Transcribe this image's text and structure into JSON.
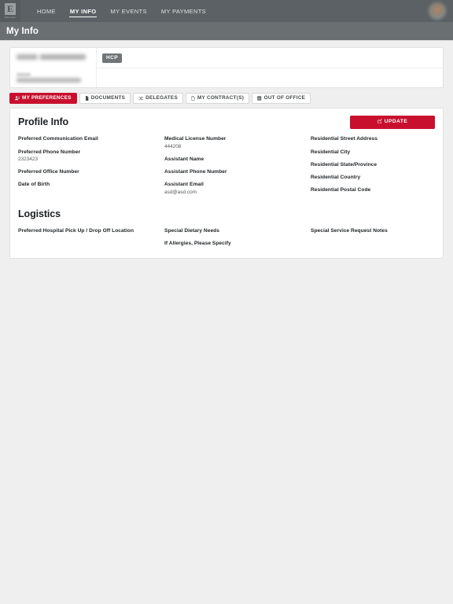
{
  "brand": {
    "logo_letter": "E",
    "logo_word": "Edwards",
    "accent_color": "#c8102e",
    "nav_color": "#5b6164",
    "titlebar_color": "#6a6f72"
  },
  "nav": {
    "items": [
      {
        "label": "HOME",
        "active": false
      },
      {
        "label": "MY INFO",
        "active": true
      },
      {
        "label": "MY EVENTS",
        "active": false
      },
      {
        "label": "MY PAYMENTS",
        "active": false
      }
    ],
    "avatar_icon": "user-avatar"
  },
  "page": {
    "title": "My Info"
  },
  "identity_card": {
    "name_redacted": true,
    "email_redacted": true,
    "badge": "HCP"
  },
  "tabs": [
    {
      "label": "MY PREFERENCES",
      "icon": "preferences-icon",
      "active": true
    },
    {
      "label": "DOCUMENTS",
      "icon": "document-icon",
      "active": false
    },
    {
      "label": "DELEGATES",
      "icon": "delegates-icon",
      "active": false
    },
    {
      "label": "MY CONTRACT(S)",
      "icon": "contract-icon",
      "active": false
    },
    {
      "label": "OUT OF OFFICE",
      "icon": "calendar-icon",
      "active": false
    }
  ],
  "profile_info": {
    "heading": "Profile Info",
    "update_label": "UPDATE",
    "update_icon": "edit-icon",
    "columns": [
      [
        {
          "label": "Preferred Communication Email",
          "value": ""
        },
        {
          "label": "Preferred Phone Number",
          "value": "2323423"
        },
        {
          "label": "Preferred Office Number",
          "value": ""
        },
        {
          "label": "Date of Birth",
          "value": ""
        }
      ],
      [
        {
          "label": "Medical License Number",
          "value": "444208"
        },
        {
          "label": "Assistant Name",
          "value": ""
        },
        {
          "label": "Assistant Phone Number",
          "value": ""
        },
        {
          "label": "Assistant Email",
          "value": "asd@asd.com"
        }
      ],
      [
        {
          "label": "Residential Street Address",
          "value": ""
        },
        {
          "label": "Residential City",
          "value": ""
        },
        {
          "label": "Residential State/Province",
          "value": ""
        },
        {
          "label": "Residential Country",
          "value": ""
        },
        {
          "label": "Residential Postal Code",
          "value": ""
        }
      ]
    ]
  },
  "logistics": {
    "heading": "Logistics",
    "columns": [
      [
        {
          "label": "Preferred Hospital Pick Up / Drop Off Location",
          "value": ""
        }
      ],
      [
        {
          "label": "Special Dietary Needs",
          "value": ""
        },
        {
          "label": "If Allergies, Please Specify",
          "value": ""
        }
      ],
      [
        {
          "label": "Special Service Request Notes",
          "value": ""
        }
      ]
    ]
  }
}
